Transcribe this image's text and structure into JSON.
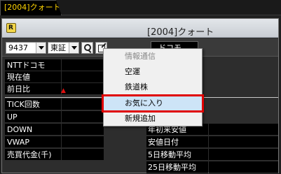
{
  "tab": {
    "label": "[2004]クォート"
  },
  "window": {
    "title": "[2004]クォート"
  },
  "toolbar": {
    "code_value": "9437",
    "market_value": "東証",
    "stock_name": "ドコモ"
  },
  "left_rows": [
    {
      "label": "NTTドコモ"
    },
    {
      "label": "現在値"
    },
    {
      "label": "前日比"
    },
    {
      "label": "TICK回数"
    },
    {
      "label": "UP"
    },
    {
      "label": "DOWN"
    },
    {
      "label": "VWAP"
    },
    {
      "label": "売買代金(千)"
    }
  ],
  "right_rows": [
    {
      "label": "年初来安値"
    },
    {
      "label": "安値日付"
    },
    {
      "label": "5日移動平均"
    },
    {
      "label": "25日移動平均"
    }
  ],
  "price_change_indicator": "▲",
  "context_menu": {
    "items": [
      {
        "label": "情報通信",
        "enabled": false
      },
      {
        "label": "空運",
        "enabled": true
      },
      {
        "label": "鉄道株",
        "enabled": true
      },
      {
        "label": "お気に入り",
        "enabled": true,
        "highlighted": true
      },
      {
        "label": "新規追加",
        "enabled": true
      }
    ]
  },
  "colors": {
    "highlight_box": "#e00000",
    "change_arrow": "#e01010",
    "tab_text": "#ffd400"
  }
}
